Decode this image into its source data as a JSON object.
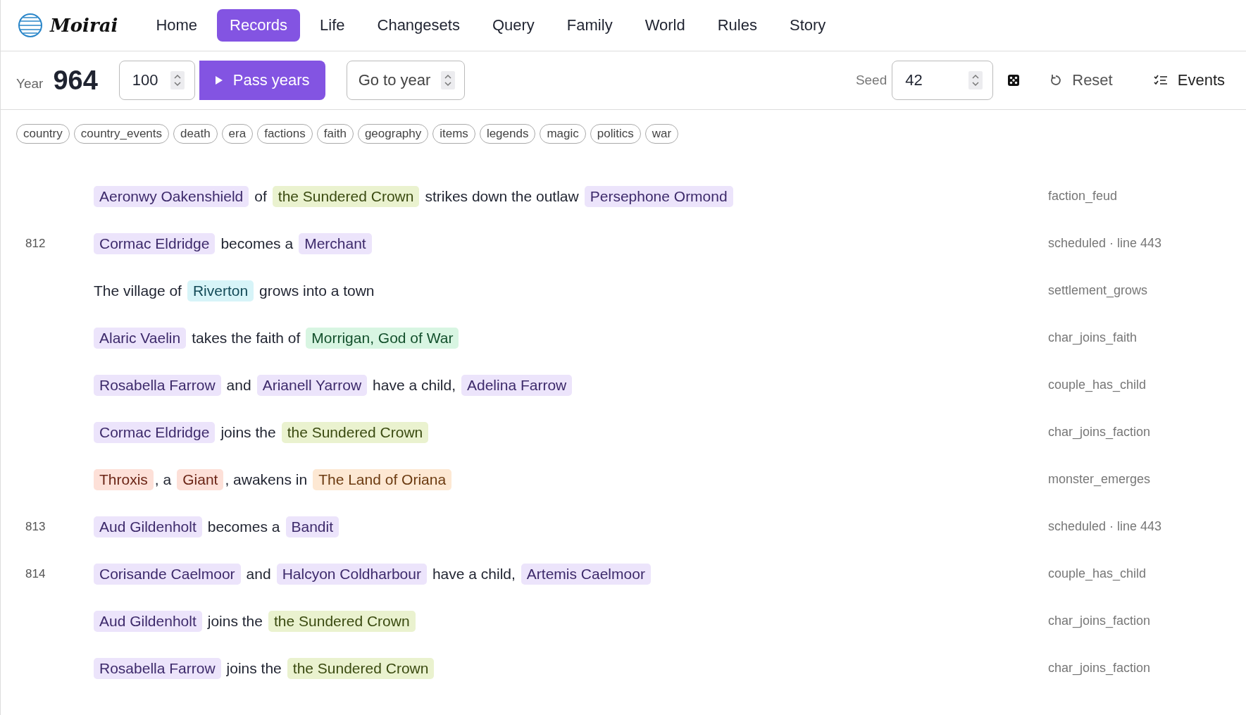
{
  "brand": "Moirai",
  "nav": [
    {
      "label": "Home",
      "selected": false
    },
    {
      "label": "Records",
      "selected": true
    },
    {
      "label": "Life",
      "selected": false
    },
    {
      "label": "Changesets",
      "selected": false
    },
    {
      "label": "Query",
      "selected": false
    },
    {
      "label": "Family",
      "selected": false
    },
    {
      "label": "World",
      "selected": false
    },
    {
      "label": "Rules",
      "selected": false
    },
    {
      "label": "Story",
      "selected": false
    }
  ],
  "toolbar": {
    "year_label": "Year",
    "year": "964",
    "years_value": "100",
    "pass_button": "Pass years",
    "goto_placeholder": "Go to year",
    "seed_label": "Seed",
    "seed_value": "42",
    "reset_button": "Reset",
    "events_button": "Events"
  },
  "tags": [
    {
      "label": "country",
      "selected": false
    },
    {
      "label": "country_events",
      "selected": false
    },
    {
      "label": "death",
      "selected": false
    },
    {
      "label": "era",
      "selected": false
    },
    {
      "label": "factions",
      "selected": false
    },
    {
      "label": "faith",
      "selected": false
    },
    {
      "label": "geography",
      "selected": false
    },
    {
      "label": "items",
      "selected": false
    },
    {
      "label": "legends",
      "selected": false
    },
    {
      "label": "magic",
      "selected": false
    },
    {
      "label": "politics",
      "selected": false
    },
    {
      "label": "war",
      "selected": false
    }
  ],
  "events": [
    {
      "parts": [
        {
          "kind": "person",
          "text": "Aeronwy Oakenshield"
        },
        {
          "kind": "text",
          "text": "of"
        },
        {
          "kind": "faction",
          "text": "the Sundered Crown"
        },
        {
          "kind": "text",
          "text": "strikes down the outlaw"
        },
        {
          "kind": "person",
          "text": "Persephone Ormond"
        }
      ],
      "source": "faction_feud"
    },
    {
      "year": "812",
      "parts": [
        {
          "kind": "person",
          "text": "Cormac Eldridge"
        },
        {
          "kind": "text",
          "text": "becomes a"
        },
        {
          "kind": "person",
          "text": "Merchant"
        }
      ],
      "source": "scheduled · line 443"
    },
    {
      "parts": [
        {
          "kind": "text",
          "text": "The village of"
        },
        {
          "kind": "settlement",
          "text": "Riverton"
        },
        {
          "kind": "text",
          "text": "grows into a town"
        }
      ],
      "source": "settlement_grows"
    },
    {
      "parts": [
        {
          "kind": "person",
          "text": "Alaric Vaelin"
        },
        {
          "kind": "text",
          "text": "takes the faith of"
        },
        {
          "kind": "deity",
          "text": "Morrigan, God of War"
        }
      ],
      "source": "char_joins_faith"
    },
    {
      "parts": [
        {
          "kind": "person",
          "text": "Rosabella Farrow"
        },
        {
          "kind": "text",
          "text": "and"
        },
        {
          "kind": "person",
          "text": "Arianell Yarrow"
        },
        {
          "kind": "text",
          "text": "have a child,"
        },
        {
          "kind": "person",
          "text": "Adelina Farrow"
        }
      ],
      "source": "couple_has_child"
    },
    {
      "parts": [
        {
          "kind": "person",
          "text": "Cormac Eldridge"
        },
        {
          "kind": "text",
          "text": "joins the"
        },
        {
          "kind": "faction",
          "text": "the Sundered Crown"
        }
      ],
      "source": "char_joins_faction"
    },
    {
      "parts": [
        {
          "kind": "monster",
          "text": "Throxis"
        },
        {
          "kind": "punct",
          "text": ", a"
        },
        {
          "kind": "monster",
          "text": "Giant"
        },
        {
          "kind": "punct",
          "text": ", awakens in"
        },
        {
          "kind": "region",
          "text": "The Land of Oriana"
        }
      ],
      "source": "monster_emerges"
    },
    {
      "year": "813",
      "parts": [
        {
          "kind": "person",
          "text": "Aud Gildenholt"
        },
        {
          "kind": "text",
          "text": "becomes a"
        },
        {
          "kind": "person",
          "text": "Bandit"
        }
      ],
      "source": "scheduled · line 443"
    },
    {
      "year": "814",
      "parts": [
        {
          "kind": "person",
          "text": "Corisande Caelmoor"
        },
        {
          "kind": "text",
          "text": "and"
        },
        {
          "kind": "person",
          "text": "Halcyon Coldharbour"
        },
        {
          "kind": "text",
          "text": "have a child,"
        },
        {
          "kind": "person",
          "text": "Artemis Caelmoor"
        }
      ],
      "source": "couple_has_child"
    },
    {
      "parts": [
        {
          "kind": "person",
          "text": "Aud Gildenholt"
        },
        {
          "kind": "text",
          "text": "joins the"
        },
        {
          "kind": "faction",
          "text": "the Sundered Crown"
        }
      ],
      "source": "char_joins_faction"
    },
    {
      "parts": [
        {
          "kind": "person",
          "text": "Rosabella Farrow"
        },
        {
          "kind": "text",
          "text": "joins the"
        },
        {
          "kind": "faction",
          "text": "the Sundered Crown"
        }
      ],
      "source": "char_joins_faction"
    }
  ]
}
